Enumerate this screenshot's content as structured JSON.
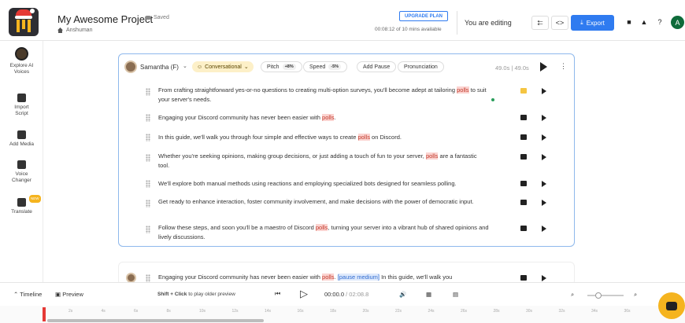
{
  "header": {
    "project_title": "My Awesome Project",
    "saved_label": "Saved",
    "owner": "Anshuman",
    "upgrade_label": "UPGRADE PLAN",
    "time_left": "00:08:12 of 10 mins available",
    "editing_label": "You are editing",
    "export_label": "Export",
    "avatar_letter": "A"
  },
  "sidebar": {
    "items": [
      {
        "label_line1": "Explore AI",
        "label_line2": "Voices"
      },
      {
        "label_line1": "Import",
        "label_line2": "Script"
      },
      {
        "label_line1": "Add Media",
        "label_line2": ""
      },
      {
        "label_line1": "Voice",
        "label_line2": "Changer"
      },
      {
        "label_line1": "Translate",
        "label_line2": "",
        "badge": "NEW"
      }
    ]
  },
  "editor": {
    "speaker": "Samantha (F)",
    "style": "Conversational",
    "pitch_label": "Pitch",
    "pitch_value": "+8%",
    "speed_label": "Speed",
    "speed_value": "-5%",
    "add_pause": "Add Pause",
    "pronunciation": "Pronunciation",
    "duration": "49.0s | 49.0s",
    "blocks": [
      {
        "pre": "From crafting straightforward yes-or-no questions to creating multi-option surveys, you'll become adept at tailoring ",
        "hl": "polls",
        "post": " to suit your server's needs."
      },
      {
        "pre": "Engaging your Discord community has never been easier with ",
        "hl": "polls",
        "post": "."
      },
      {
        "pre": "In this guide, we'll walk you through four simple and effective ways to create ",
        "hl": "polls",
        "post": " on Discord."
      },
      {
        "pre": "Whether you're seeking opinions, making group decisions, or just adding a touch of fun to your server, ",
        "hl": "polls",
        "post": " are a fantastic tool."
      },
      {
        "pre": "We'll explore both manual methods using reactions and employing specialized bots designed for seamless polling.",
        "hl": "",
        "post": ""
      },
      {
        "pre": "Get ready to enhance interaction, foster community involvement, and make decisions with the power of democratic input.",
        "hl": "",
        "post": ""
      },
      {
        "pre": "Follow these steps, and soon you'll be a maestro of Discord ",
        "hl": "polls",
        "post": ", turning your server into a vibrant hub of shared opinions and lively discussions."
      }
    ]
  },
  "editor2": {
    "pre": "Engaging your Discord community has never been easier with ",
    "hl": "polls",
    "mid": ". ",
    "tag": "[pause medium]",
    "post": " In this guide, we'll walk you"
  },
  "bottom": {
    "timeline_label": "Timeline",
    "preview_label": "Preview",
    "hint_bold": "Shift + Click",
    "hint_rest": " to play older preview",
    "time_current": "00:00.0",
    "time_total": "02:08.8"
  },
  "ruler": [
    "2s",
    "4s",
    "6s",
    "8s",
    "10s",
    "12s",
    "14s",
    "16s",
    "18s",
    "20s",
    "22s",
    "24s",
    "26s",
    "28s",
    "30s",
    "32s",
    "34s",
    "36s"
  ],
  "colors": {
    "accent": "#2f7bf0",
    "brand": "#f5b41f",
    "highlight": "#fbd3d0"
  }
}
